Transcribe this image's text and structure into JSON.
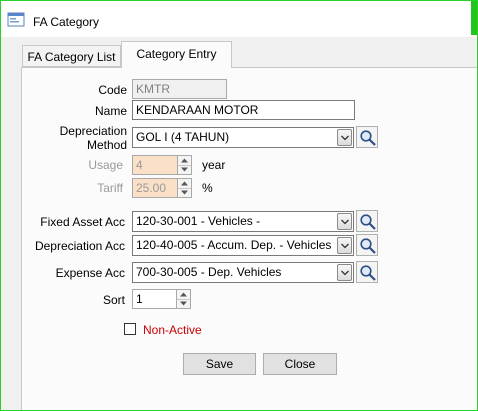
{
  "window": {
    "title": "FA Category",
    "icon": "app-form-icon"
  },
  "tabs": [
    {
      "label": "FA Category List",
      "active": false
    },
    {
      "label": "Category Entry",
      "active": true
    }
  ],
  "form": {
    "code": {
      "label": "Code",
      "value": "KMTR"
    },
    "name": {
      "label": "Name",
      "value": "KENDARAAN MOTOR"
    },
    "depreciation_method": {
      "label_line1": "Depreciation",
      "label_line2": "Method",
      "value": "GOL I (4 TAHUN)"
    },
    "usage": {
      "label": "Usage",
      "value": "4",
      "unit": "year"
    },
    "tariff": {
      "label": "Tariff",
      "value": "25.00",
      "unit": "%"
    },
    "fixed_asset_acc": {
      "label": "Fixed Asset Acc",
      "value": "120-30-001 - Vehicles -"
    },
    "depreciation_acc": {
      "label": "Depreciation Acc",
      "value": "120-40-005 - Accum. Dep. - Vehicles"
    },
    "expense_acc": {
      "label": "Expense Acc",
      "value": "700-30-005 - Dep. Vehicles"
    },
    "sort": {
      "label": "Sort",
      "value": "1"
    },
    "non_active": {
      "label": "Non-Active",
      "checked": false,
      "color": "#cc0000"
    }
  },
  "buttons": {
    "save": "Save",
    "close": "Close"
  },
  "colors": {
    "window_border": "#2bd12b",
    "peach_field": "#fbe0c8"
  }
}
